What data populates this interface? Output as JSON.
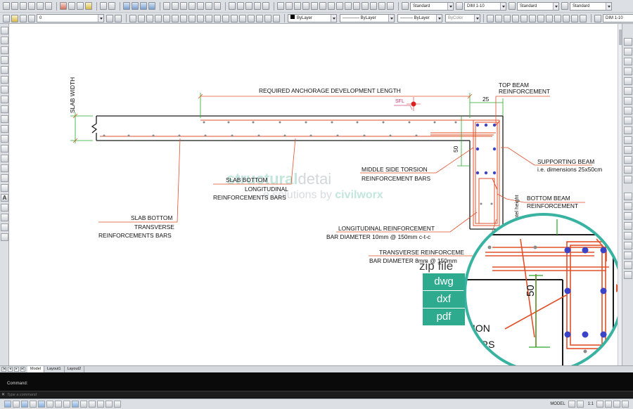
{
  "toolbar": {
    "layer_value": "0",
    "layer_color_value": "ByLayer",
    "linetype_value": "ByLayer",
    "lineweight_value": "ByLayer",
    "plotstyle_value": "ByColor",
    "text_style_value": "Standard",
    "dim_style_value": "DIM 1-10",
    "table_style_value": "Standard",
    "multileader_style_value": "Standard",
    "dim_style2_value": "DIM 1-10"
  },
  "drawing": {
    "slab_width": "SLAB WIDTH",
    "required_anchorage": "REQUIRED ANCHORAGE DEVELOPMENT LENGTH",
    "sfl": "SFL",
    "dim_25": "25",
    "dim_50": "50",
    "top_beam": [
      "TOP BEAM",
      "REINFORCEMENT"
    ],
    "supporting_beam": [
      "SUPPORTING BEAM",
      "i.e. dimensions 25x50cm"
    ],
    "middle_side_torsion": [
      "MIDDLE SIDE TORSION",
      "REINFORCEMENT BARS"
    ],
    "slab_bottom_long": [
      "SLAB BOTTOM",
      "LONGITUDINAL",
      "REINFORCEMENTS BARS"
    ],
    "bottom_beam": [
      "BOTTOM BEAM",
      "REINFORCEMENT"
    ],
    "slab_bottom_trans": [
      "SLAB BOTTOM",
      "TRANSVERSE",
      "REINFORCEMENTS BARS"
    ],
    "longitudinal_reinf": [
      "LONGITUDINAL REINFORCEMENT",
      "BAR DIAMETER 10mm @ 150mm c-t-c"
    ],
    "transverse_reinf": [
      "TRANSVERSE REINFORCEME",
      "BAR DIAMETER 8mm @ 150mm"
    ],
    "lintel_height": "ntel height",
    "watermark_line1_a": "structural",
    "watermark_line1_b": "detai",
    "watermark_line2_a": "e solutions by ",
    "watermark_line2_b": "civilworx",
    "zoom_50": "50",
    "zoom_ion": "ION",
    "zoom_rs": "RS"
  },
  "zip_badge": {
    "label": "zip file",
    "formats": [
      "dwg",
      "dxf",
      "pdf"
    ]
  },
  "tabs": {
    "model": "Model",
    "layout1": "Layout1",
    "layout2": "Layout2"
  },
  "command": {
    "history": "Command:",
    "placeholder": "Type a command"
  },
  "status": {
    "model_label": "MODEL",
    "scale": "1:1"
  },
  "colors": {
    "slab_outline": "#1a1a1a",
    "reinforcement": "#e0502a",
    "leader": "#e0502a",
    "dimension": "#2aa82a",
    "stirrup_dot": "#3a44c8",
    "zoom_ring": "#39b3a1",
    "badge": "#2eaa8e"
  }
}
